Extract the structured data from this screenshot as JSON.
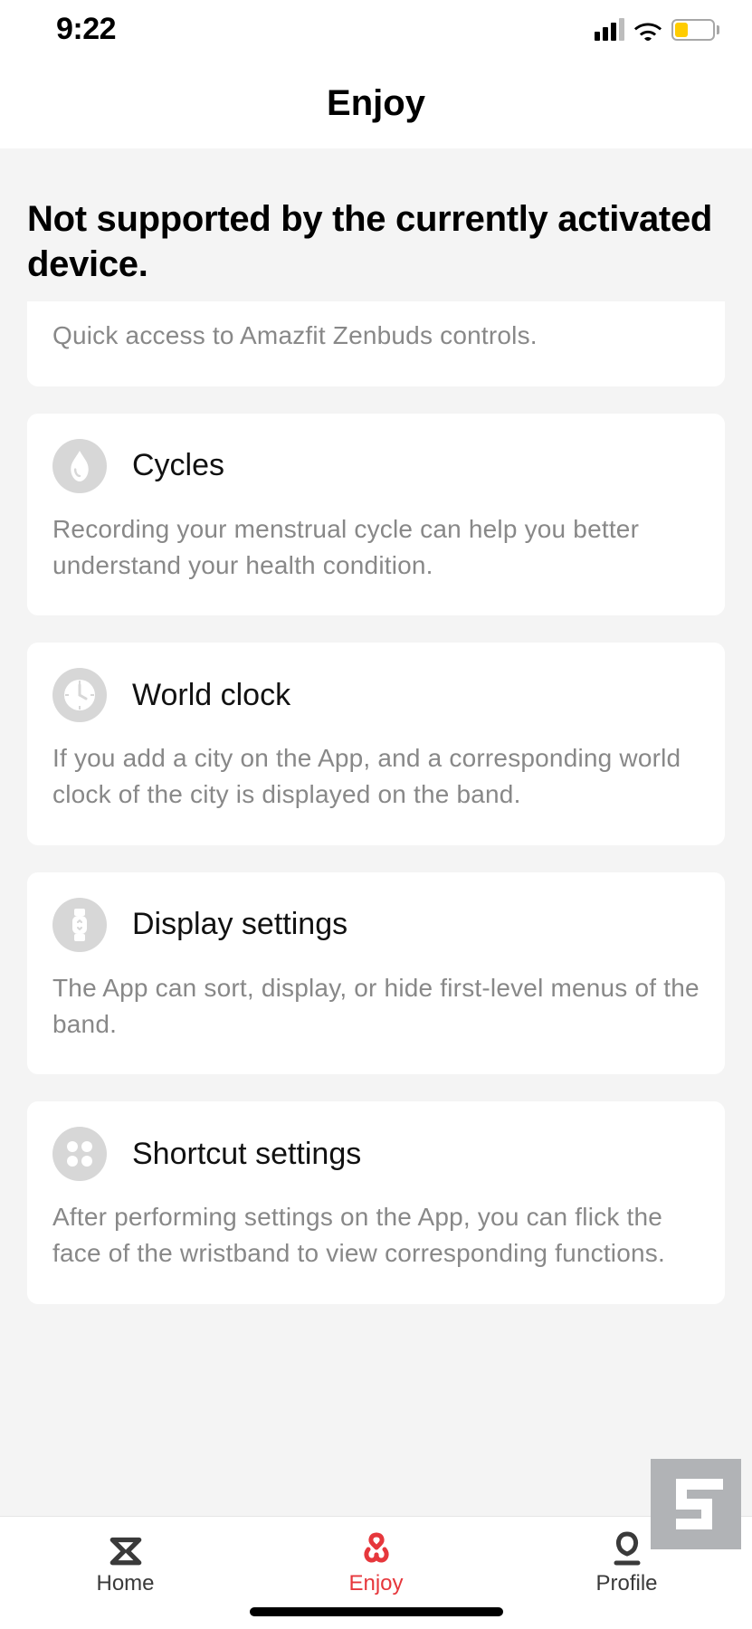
{
  "status": {
    "time": "9:22"
  },
  "header": {
    "title": "Enjoy"
  },
  "section_heading": "Not supported by the currently activated device.",
  "cards": {
    "zenbuds": {
      "desc": "Quick access to Amazfit Zenbuds controls."
    },
    "cycles": {
      "title": "Cycles",
      "desc": "Recording your menstrual cycle can help you better understand your health condition."
    },
    "worldclock": {
      "title": "World clock",
      "desc": "If you add a city on the App, and a corresponding world clock of the city is displayed on the band."
    },
    "display": {
      "title": "Display settings",
      "desc": "The App can sort, display, or hide first-level menus of the band."
    },
    "shortcut": {
      "title": "Shortcut settings",
      "desc": "After performing settings on the App, you can flick the face of the wristband to view corresponding functions."
    }
  },
  "tabs": {
    "home": {
      "label": "Home"
    },
    "enjoy": {
      "label": "Enjoy"
    },
    "profile": {
      "label": "Profile"
    }
  }
}
